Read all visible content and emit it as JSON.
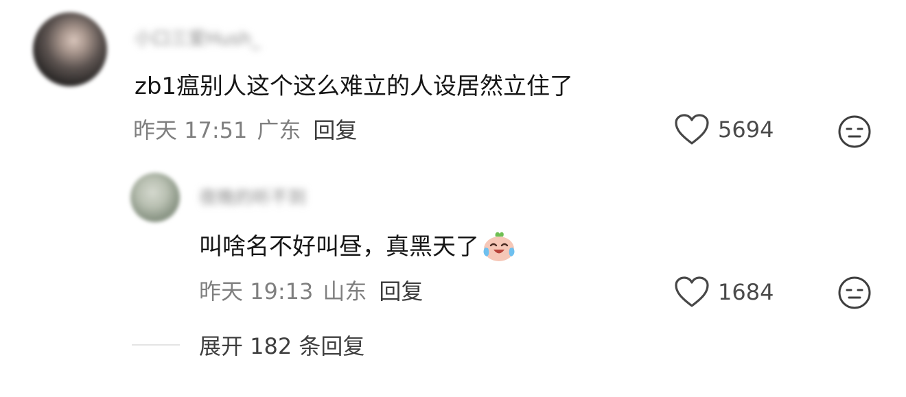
{
  "comment": {
    "author_name": "小口三爱Hush_",
    "text": "zb1瘟别人这个这么难立的人设居然立住了",
    "time": "昨天 17:51",
    "location": "广东",
    "reply_label": "回复",
    "likes": "5694"
  },
  "reply": {
    "author_name": "夜晚的听不到",
    "text": "叫啥名不好叫昼，真黑天了",
    "emoji": "crying-laughing-emoji",
    "time": "昨天 19:13",
    "location": "山东",
    "reply_label": "回复",
    "likes": "1684"
  },
  "expand": {
    "label": "展开 182 条回复"
  },
  "icons": {
    "like": "heart-outline-icon",
    "dislike": "neutral-face-icon"
  }
}
